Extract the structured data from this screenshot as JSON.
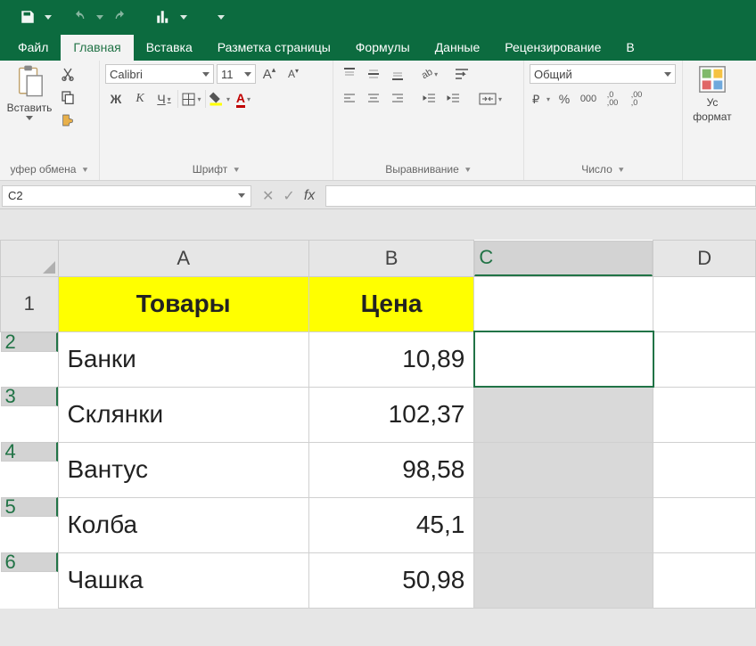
{
  "qat": {
    "tooltip_save": "Сохранить",
    "tooltip_undo": "Отменить",
    "tooltip_redo": "Вернуть"
  },
  "tabs": {
    "file": "Файл",
    "home": "Главная",
    "insert": "Вставка",
    "pagelayout": "Разметка страницы",
    "formulas": "Формулы",
    "data": "Данные",
    "review": "Рецензирование",
    "view_cut": "В"
  },
  "ribbon": {
    "clipboard": {
      "paste": "Вставить",
      "label": "уфер обмена",
      "dlg": "⤓"
    },
    "font": {
      "name": "Calibri",
      "size": "11",
      "bold": "Ж",
      "italic": "К",
      "underline": "Ч",
      "label": "Шрифт"
    },
    "alignment": {
      "label": "Выравнивание"
    },
    "number": {
      "format": "Общий",
      "label": "Число"
    },
    "styles": {
      "cond_line1": "Ус",
      "cond_line2": "формат"
    }
  },
  "formula_bar": {
    "cell_ref": "C2",
    "fx": "fx",
    "value": ""
  },
  "grid": {
    "columns": [
      "A",
      "B",
      "C",
      "D"
    ],
    "rows": [
      {
        "n": "1",
        "a": "Товары",
        "b": "Цена",
        "header": true
      },
      {
        "n": "2",
        "a": "Банки",
        "b": "10,89"
      },
      {
        "n": "3",
        "a": "Склянки",
        "b": "102,37"
      },
      {
        "n": "4",
        "a": "Вантус",
        "b": "98,58"
      },
      {
        "n": "5",
        "a": "Колба",
        "b": "45,1"
      },
      {
        "n": "6",
        "a": "Чашка",
        "b": "50,98"
      }
    ],
    "active_cell": "C2",
    "selection": "C2:C6"
  }
}
